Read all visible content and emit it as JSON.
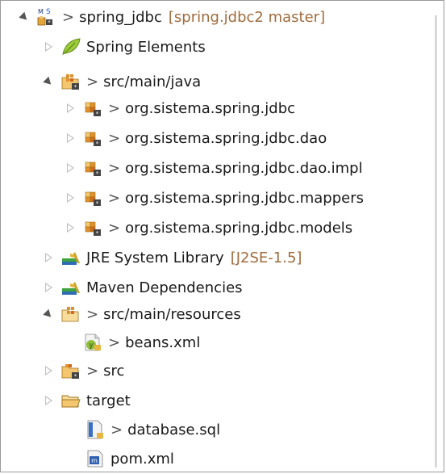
{
  "tree": {
    "items": [
      {
        "label": "spring_jdbc",
        "decoration": "[spring.jdbc2 master]",
        "git_prefix": ">",
        "icon": "maven-spring-project-icon",
        "expanded": true
      },
      {
        "label": "Spring Elements",
        "icon": "spring-leaf-icon",
        "expanded": false
      },
      {
        "label": "src/main/java",
        "git_prefix": ">",
        "icon": "source-folder-icon",
        "expanded": true
      },
      {
        "label": "org.sistema.spring.jdbc",
        "git_prefix": ">",
        "icon": "package-icon",
        "expanded": false
      },
      {
        "label": "org.sistema.spring.jdbc.dao",
        "git_prefix": ">",
        "icon": "package-icon",
        "expanded": false
      },
      {
        "label": "org.sistema.spring.jdbc.dao.impl",
        "git_prefix": ">",
        "icon": "package-icon",
        "expanded": false
      },
      {
        "label": "org.sistema.spring.jdbc.mappers",
        "git_prefix": ">",
        "icon": "package-icon",
        "expanded": false
      },
      {
        "label": "org.sistema.spring.jdbc.models",
        "git_prefix": ">",
        "icon": "package-icon",
        "expanded": false
      },
      {
        "label": "JRE System Library",
        "decoration": "[J2SE-1.5]",
        "icon": "library-icon",
        "expanded": false
      },
      {
        "label": "Maven Dependencies",
        "icon": "library-icon",
        "expanded": false
      },
      {
        "label": "src/main/resources",
        "git_prefix": ">",
        "icon": "source-folder-icon",
        "expanded": true
      },
      {
        "label": "beans.xml",
        "git_prefix": ">",
        "icon": "spring-beans-xml-icon",
        "leaf": true
      },
      {
        "label": "src",
        "git_prefix": ">",
        "icon": "folder-package-icon",
        "expanded": false
      },
      {
        "label": "target",
        "icon": "folder-icon",
        "expanded": false
      },
      {
        "label": "database.sql",
        "git_prefix": ">",
        "icon": "sql-file-icon",
        "leaf": true
      },
      {
        "label": "pom.xml",
        "icon": "maven-pom-icon",
        "leaf": true
      }
    ]
  }
}
